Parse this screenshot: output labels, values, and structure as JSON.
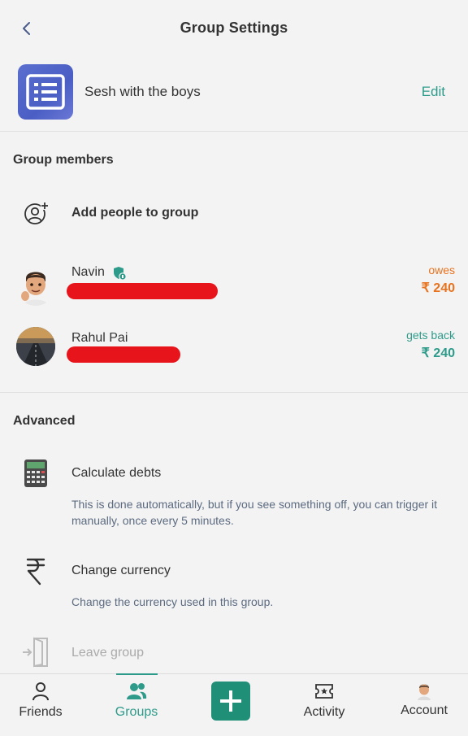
{
  "header": {
    "title": "Group Settings"
  },
  "group": {
    "name": "Sesh with the boys",
    "edit_label": "Edit"
  },
  "members_section": {
    "title": "Group members",
    "add_label": "Add people to group",
    "members": [
      {
        "name": "Navin",
        "balance_label": "owes",
        "amount": "₹ 240",
        "status": "owes"
      },
      {
        "name": "Rahul Pai",
        "balance_label": "gets back",
        "amount": "₹ 240",
        "status": "gets_back"
      }
    ]
  },
  "advanced": {
    "title": "Advanced",
    "items": [
      {
        "label": "Calculate debts",
        "description": "This is done automatically, but if you see something off, you can trigger it manually, once every 5 minutes."
      },
      {
        "label": "Change currency",
        "description": "Change the currency used in this group."
      },
      {
        "label": "Leave group"
      }
    ]
  },
  "nav": {
    "items": [
      {
        "label": "Friends",
        "icon": "person-icon"
      },
      {
        "label": "Groups",
        "icon": "groups-icon",
        "active": true
      },
      {
        "label": "",
        "icon": "plus-icon"
      },
      {
        "label": "Activity",
        "icon": "ticket-icon"
      },
      {
        "label": "Account",
        "icon": "account-avatar-icon"
      }
    ]
  },
  "colors": {
    "accent": "#2e9b8a",
    "owes": "#e8731f",
    "fab": "#1f8f78"
  }
}
